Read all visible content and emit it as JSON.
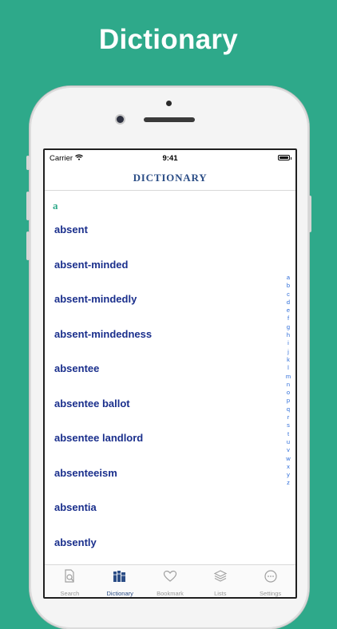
{
  "banner": {
    "title": "Dictionary"
  },
  "status_bar": {
    "carrier": "Carrier",
    "time": "9:41"
  },
  "nav": {
    "title": "DICTIONARY"
  },
  "list": {
    "section": "a",
    "words": [
      "absent",
      "absent-minded",
      "absent-mindedly",
      "absent-mindedness",
      "absentee",
      "absentee ballot",
      "absentee landlord",
      "absenteeism",
      "absentia",
      "absently"
    ]
  },
  "index_letters": [
    "a",
    "b",
    "c",
    "d",
    "e",
    "f",
    "g",
    "h",
    "i",
    "j",
    "k",
    "l",
    "m",
    "n",
    "o",
    "p",
    "q",
    "r",
    "s",
    "t",
    "u",
    "v",
    "w",
    "x",
    "y",
    "z"
  ],
  "tabs": [
    {
      "label": "Search",
      "icon": "search-icon",
      "active": false
    },
    {
      "label": "Dictionary",
      "icon": "books-icon",
      "active": true
    },
    {
      "label": "Bookmark",
      "icon": "heart-icon",
      "active": false
    },
    {
      "label": "Lists",
      "icon": "layers-icon",
      "active": false
    },
    {
      "label": "Settings",
      "icon": "more-icon",
      "active": false
    }
  ],
  "colors": {
    "background": "#2ea98a",
    "accent": "#2b4d86",
    "word_text": "#1a2f8c",
    "index_text": "#2d6cd8",
    "section_header": "#2ea98a",
    "tab_inactive": "#9a9a9a"
  }
}
